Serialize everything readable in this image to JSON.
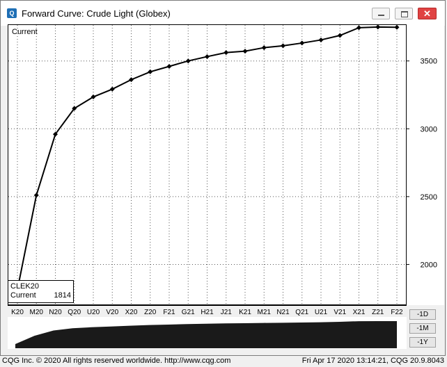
{
  "window": {
    "title": "Forward Curve: Crude Light (Globex)",
    "app_icon": "cqg-app-icon",
    "buttons": {
      "minimize": "minimize-icon",
      "maximize": "maximize-icon",
      "close": "✕"
    }
  },
  "legend": {
    "symbol": "CLEK20",
    "label": "Current",
    "value": "1814"
  },
  "series_tag": "Current",
  "range_buttons": [
    "-1D",
    "-1M",
    "-1Y"
  ],
  "status": {
    "left": "CQG Inc. © 2020 All rights reserved worldwide. http://www.cqg.com",
    "right": "Fri Apr 17 2020 13:14:21, CQG 20.9.8043"
  },
  "colors": {
    "line": "#000000",
    "grid": "#555555",
    "navigator_fill": "#1a1a1a"
  },
  "chart_data": {
    "type": "line",
    "categories": [
      "K20",
      "M20",
      "N20",
      "Q20",
      "U20",
      "V20",
      "X20",
      "Z20",
      "F21",
      "G21",
      "H21",
      "J21",
      "K21",
      "M21",
      "N21",
      "Q21",
      "U21",
      "V21",
      "X21",
      "Z21",
      "F22"
    ],
    "series": [
      {
        "name": "Current",
        "values": [
          1814,
          2510,
          2960,
          3150,
          3235,
          3292,
          3362,
          3420,
          3460,
          3500,
          3532,
          3562,
          3572,
          3598,
          3612,
          3632,
          3655,
          3688,
          3745,
          3750,
          3748
        ]
      }
    ],
    "yticks": [
      2000,
      2500,
      3000,
      3500
    ],
    "ylim": [
      1700,
      3770
    ],
    "grid": true,
    "navigator": true
  }
}
